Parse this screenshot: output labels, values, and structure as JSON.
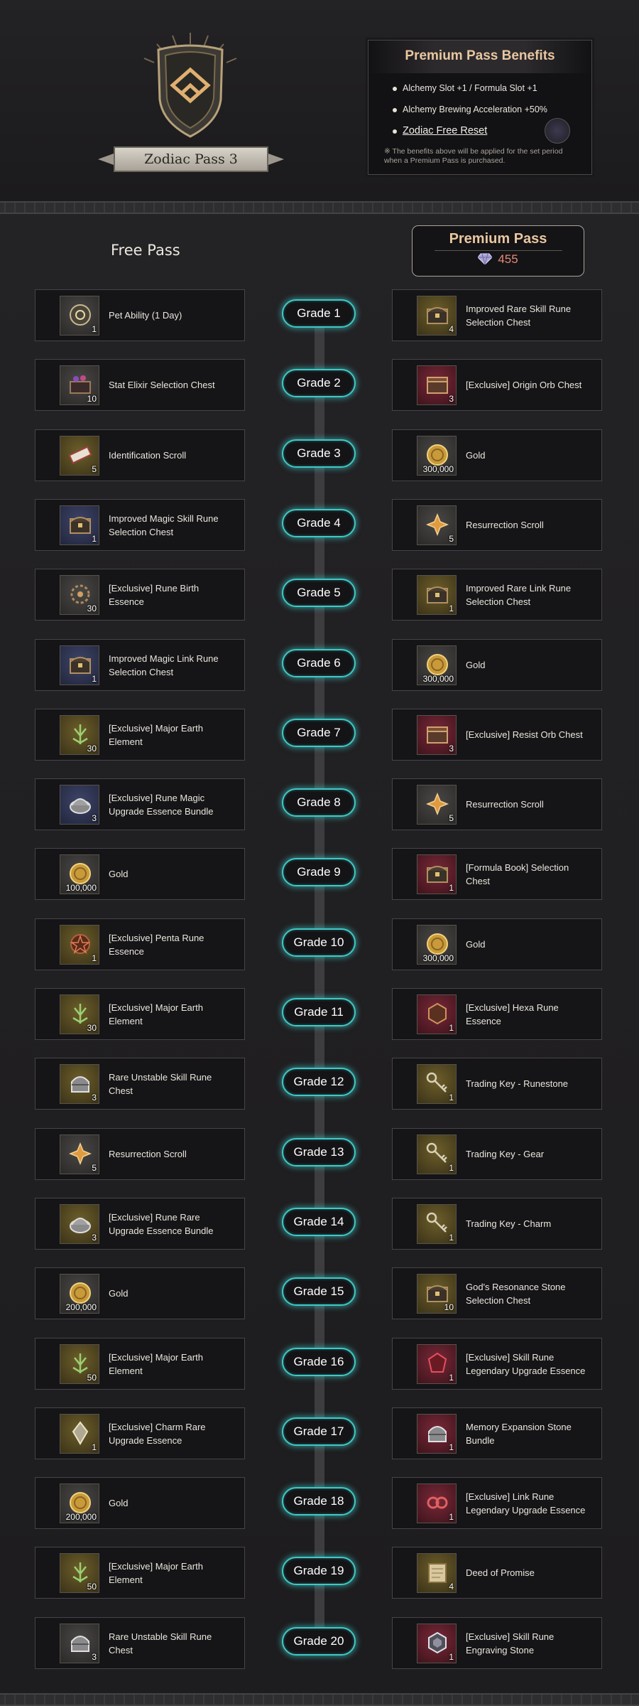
{
  "header": {
    "title": "Zodiac Pass 3",
    "benefits": {
      "title": "Premium Pass Benefits",
      "items": [
        "Alchemy Slot +1 / Formula Slot +1",
        "Alchemy Brewing Acceleration +50%",
        "Zodiac Free Reset"
      ],
      "note": "※ The benefits above will be applied for the set period when a Premium Pass is purchased."
    }
  },
  "columns": {
    "free_label": "Free Pass",
    "premium_label": "Premium Pass",
    "premium_price": "455"
  },
  "colors": {
    "grade_glow": "#3ec9c6",
    "premium_title": "#e9c7a1",
    "price": "#e58a78"
  },
  "rows": [
    {
      "grade": "Grade 1",
      "free": {
        "name": "Pet Ability (1 Day)",
        "qty": "1",
        "icon": "pet-coin-icon",
        "color": "gray"
      },
      "premium": {
        "name": "Improved Rare Skill Rune Selection Chest",
        "qty": "4",
        "icon": "chest-icon",
        "color": "yellow"
      }
    },
    {
      "grade": "Grade 2",
      "free": {
        "name": "Stat Elixir Selection Chest",
        "qty": "10",
        "icon": "elixir-chest-icon",
        "color": "gray"
      },
      "premium": {
        "name": "[Exclusive] Origin Orb Chest",
        "qty": "3",
        "icon": "orb-chest-icon",
        "color": "red"
      }
    },
    {
      "grade": "Grade 3",
      "free": {
        "name": "Identification Scroll",
        "qty": "5",
        "icon": "scroll-icon",
        "color": "yellow"
      },
      "premium": {
        "name": "Gold",
        "qty": "300,000",
        "icon": "gold-coin-icon",
        "color": "gray"
      }
    },
    {
      "grade": "Grade 4",
      "free": {
        "name": "Improved Magic Skill Rune Selection Chest",
        "qty": "1",
        "icon": "chest-icon",
        "color": "blue"
      },
      "premium": {
        "name": "Resurrection Scroll",
        "qty": "5",
        "icon": "resurrection-scroll-icon",
        "color": "gray"
      }
    },
    {
      "grade": "Grade 5",
      "free": {
        "name": "[Exclusive] Rune Birth Essence",
        "qty": "30",
        "icon": "rune-essence-icon",
        "color": "gray"
      },
      "premium": {
        "name": "Improved Rare Link Rune Selection Chest",
        "qty": "1",
        "icon": "chest-icon",
        "color": "yellow"
      }
    },
    {
      "grade": "Grade 6",
      "free": {
        "name": "Improved Magic Link Rune Selection Chest",
        "qty": "1",
        "icon": "chest-icon",
        "color": "blue"
      },
      "premium": {
        "name": "Gold",
        "qty": "300,000",
        "icon": "gold-coin-icon",
        "color": "gray"
      }
    },
    {
      "grade": "Grade 7",
      "free": {
        "name": "[Exclusive] Major Earth Element",
        "qty": "30",
        "icon": "earth-element-icon",
        "color": "yellow"
      },
      "premium": {
        "name": "[Exclusive] Resist Orb Chest",
        "qty": "3",
        "icon": "orb-chest-icon",
        "color": "red"
      }
    },
    {
      "grade": "Grade 8",
      "free": {
        "name": "[Exclusive] Rune Magic Upgrade Essence Bundle",
        "qty": "3",
        "icon": "essence-bundle-icon",
        "color": "blue"
      },
      "premium": {
        "name": "Resurrection Scroll",
        "qty": "5",
        "icon": "resurrection-scroll-icon",
        "color": "gray"
      }
    },
    {
      "grade": "Grade 9",
      "free": {
        "name": "Gold",
        "qty": "100,000",
        "icon": "gold-coin-icon",
        "color": "gray"
      },
      "premium": {
        "name": "[Formula Book] Selection Chest",
        "qty": "1",
        "icon": "chest-icon",
        "color": "red"
      }
    },
    {
      "grade": "Grade 10",
      "free": {
        "name": "[Exclusive] Penta Rune Essence",
        "qty": "1",
        "icon": "penta-rune-icon",
        "color": "yellow"
      },
      "premium": {
        "name": "Gold",
        "qty": "300,000",
        "icon": "gold-coin-icon",
        "color": "gray"
      }
    },
    {
      "grade": "Grade 11",
      "free": {
        "name": "[Exclusive] Major Earth Element",
        "qty": "30",
        "icon": "earth-element-icon",
        "color": "yellow"
      },
      "premium": {
        "name": "[Exclusive] Hexa Rune Essence",
        "qty": "1",
        "icon": "hexa-rune-icon",
        "color": "red"
      }
    },
    {
      "grade": "Grade 12",
      "free": {
        "name": "Rare Unstable Skill Rune Chest",
        "qty": "3",
        "icon": "helmet-chest-icon",
        "color": "yellow"
      },
      "premium": {
        "name": "Trading Key - Runestone",
        "qty": "1",
        "icon": "key-icon",
        "color": "yellow"
      }
    },
    {
      "grade": "Grade 13",
      "free": {
        "name": "Resurrection Scroll",
        "qty": "5",
        "icon": "resurrection-scroll-icon",
        "color": "gray"
      },
      "premium": {
        "name": "Trading Key - Gear",
        "qty": "1",
        "icon": "key-icon",
        "color": "yellow"
      }
    },
    {
      "grade": "Grade 14",
      "free": {
        "name": "[Exclusive] Rune Rare Upgrade Essence Bundle",
        "qty": "3",
        "icon": "essence-bundle-icon",
        "color": "yellow"
      },
      "premium": {
        "name": "Trading Key - Charm",
        "qty": "1",
        "icon": "key-icon",
        "color": "yellow"
      }
    },
    {
      "grade": "Grade 15",
      "free": {
        "name": "Gold",
        "qty": "200,000",
        "icon": "gold-coin-icon",
        "color": "gray"
      },
      "premium": {
        "name": "God's Resonance Stone Selection Chest",
        "qty": "10",
        "icon": "chest-icon",
        "color": "yellow"
      }
    },
    {
      "grade": "Grade 16",
      "free": {
        "name": "[Exclusive] Major Earth Element",
        "qty": "50",
        "icon": "earth-element-icon",
        "color": "yellow"
      },
      "premium": {
        "name": "[Exclusive] Skill Rune Legendary Upgrade Essence",
        "qty": "1",
        "icon": "legendary-essence-icon",
        "color": "red"
      }
    },
    {
      "grade": "Grade 17",
      "free": {
        "name": "[Exclusive] Charm Rare Upgrade Essence",
        "qty": "1",
        "icon": "charm-essence-icon",
        "color": "yellow"
      },
      "premium": {
        "name": "Memory Expansion Stone Bundle",
        "qty": "1",
        "icon": "helmet-chest-icon",
        "color": "red"
      }
    },
    {
      "grade": "Grade 18",
      "free": {
        "name": "Gold",
        "qty": "200,000",
        "icon": "gold-coin-icon",
        "color": "gray"
      },
      "premium": {
        "name": "[Exclusive] Link Rune Legendary Upgrade Essence",
        "qty": "1",
        "icon": "link-rune-icon",
        "color": "red"
      }
    },
    {
      "grade": "Grade 19",
      "free": {
        "name": "[Exclusive] Major Earth Element",
        "qty": "50",
        "icon": "earth-element-icon",
        "color": "yellow"
      },
      "premium": {
        "name": "Deed of Promise",
        "qty": "4",
        "icon": "deed-icon",
        "color": "yellow"
      }
    },
    {
      "grade": "Grade 20",
      "free": {
        "name": "Rare Unstable Skill Rune Chest",
        "qty": "3",
        "icon": "helmet-chest-icon",
        "color": "gray"
      },
      "premium": {
        "name": "[Exclusive] Skill Rune Engraving Stone",
        "qty": "1",
        "icon": "engraving-stone-icon",
        "color": "red"
      }
    }
  ]
}
